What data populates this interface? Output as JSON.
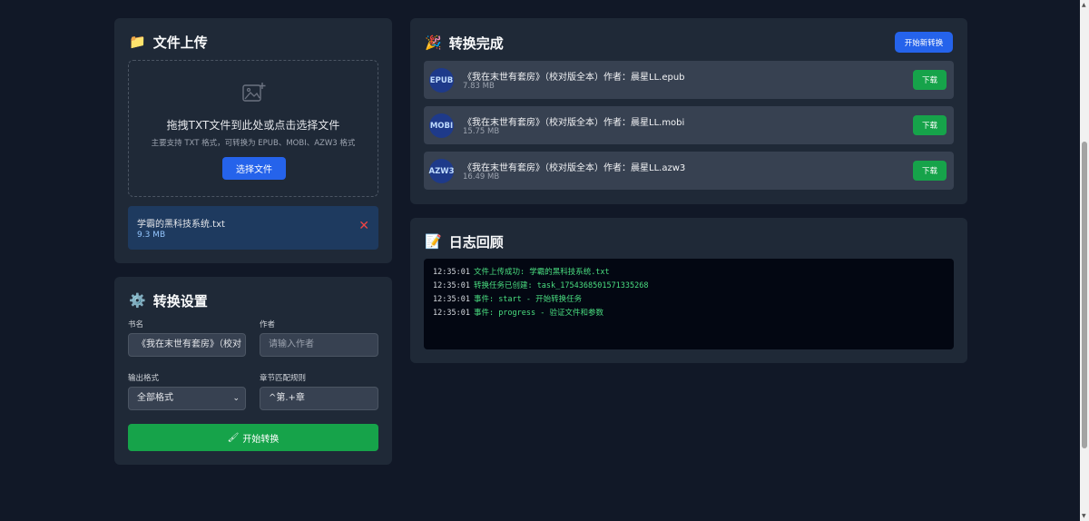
{
  "upload": {
    "title": "文件上传",
    "emoji": "📁",
    "drop_title": "拖拽TXT文件到此处或点击选择文件",
    "drop_sub": "主要支持 TXT 格式，可转换为 EPUB、MOBI、AZW3 格式",
    "select_label": "选择文件",
    "file_name": "学霸的黑科技系统.txt",
    "file_size": "9.3 MB",
    "remove_glyph": "✕"
  },
  "settings": {
    "title": "转换设置",
    "emoji": "⚙️",
    "book_label": "书名",
    "book_value": "《我在末世有套房》（校对",
    "author_label": "作者",
    "author_placeholder": "请输入作者",
    "format_label": "输出格式",
    "format_value": "全部格式",
    "chapter_label": "章节匹配规则",
    "chapter_value": "^第.+章",
    "convert_icon": "🖌",
    "convert_label": "开始转换"
  },
  "result": {
    "title": "转换完成",
    "emoji": "🎉",
    "new_label": "开始新转换",
    "download_label": "下载",
    "items": [
      {
        "format": "EPUB",
        "name": "《我在末世有套房》（校对版全本）作者：晨星LL.epub",
        "size": "7.83 MB"
      },
      {
        "format": "MOBI",
        "name": "《我在末世有套房》（校对版全本）作者：晨星LL.mobi",
        "size": "15.75 MB"
      },
      {
        "format": "AZW3",
        "name": "《我在末世有套房》（校对版全本）作者：晨星LL.azw3",
        "size": "16.49 MB"
      }
    ]
  },
  "log": {
    "title": "日志回顾",
    "emoji": "📝",
    "lines": [
      {
        "time": "12:35:01",
        "msg": "文件上传成功: 学霸的黑科技系统.txt"
      },
      {
        "time": "12:35:01",
        "msg": "转换任务已创建: task_1754368501571335268"
      },
      {
        "time": "12:35:01",
        "msg": "事件: start - 开始转换任务"
      },
      {
        "time": "12:35:01",
        "msg": "事件: progress - 验证文件和参数"
      }
    ]
  },
  "colors": {
    "background": "#111827",
    "card": "#1f2937",
    "primary": "#2563eb",
    "success": "#16a34a",
    "danger": "#ef4444",
    "log_text": "#4ade80"
  }
}
